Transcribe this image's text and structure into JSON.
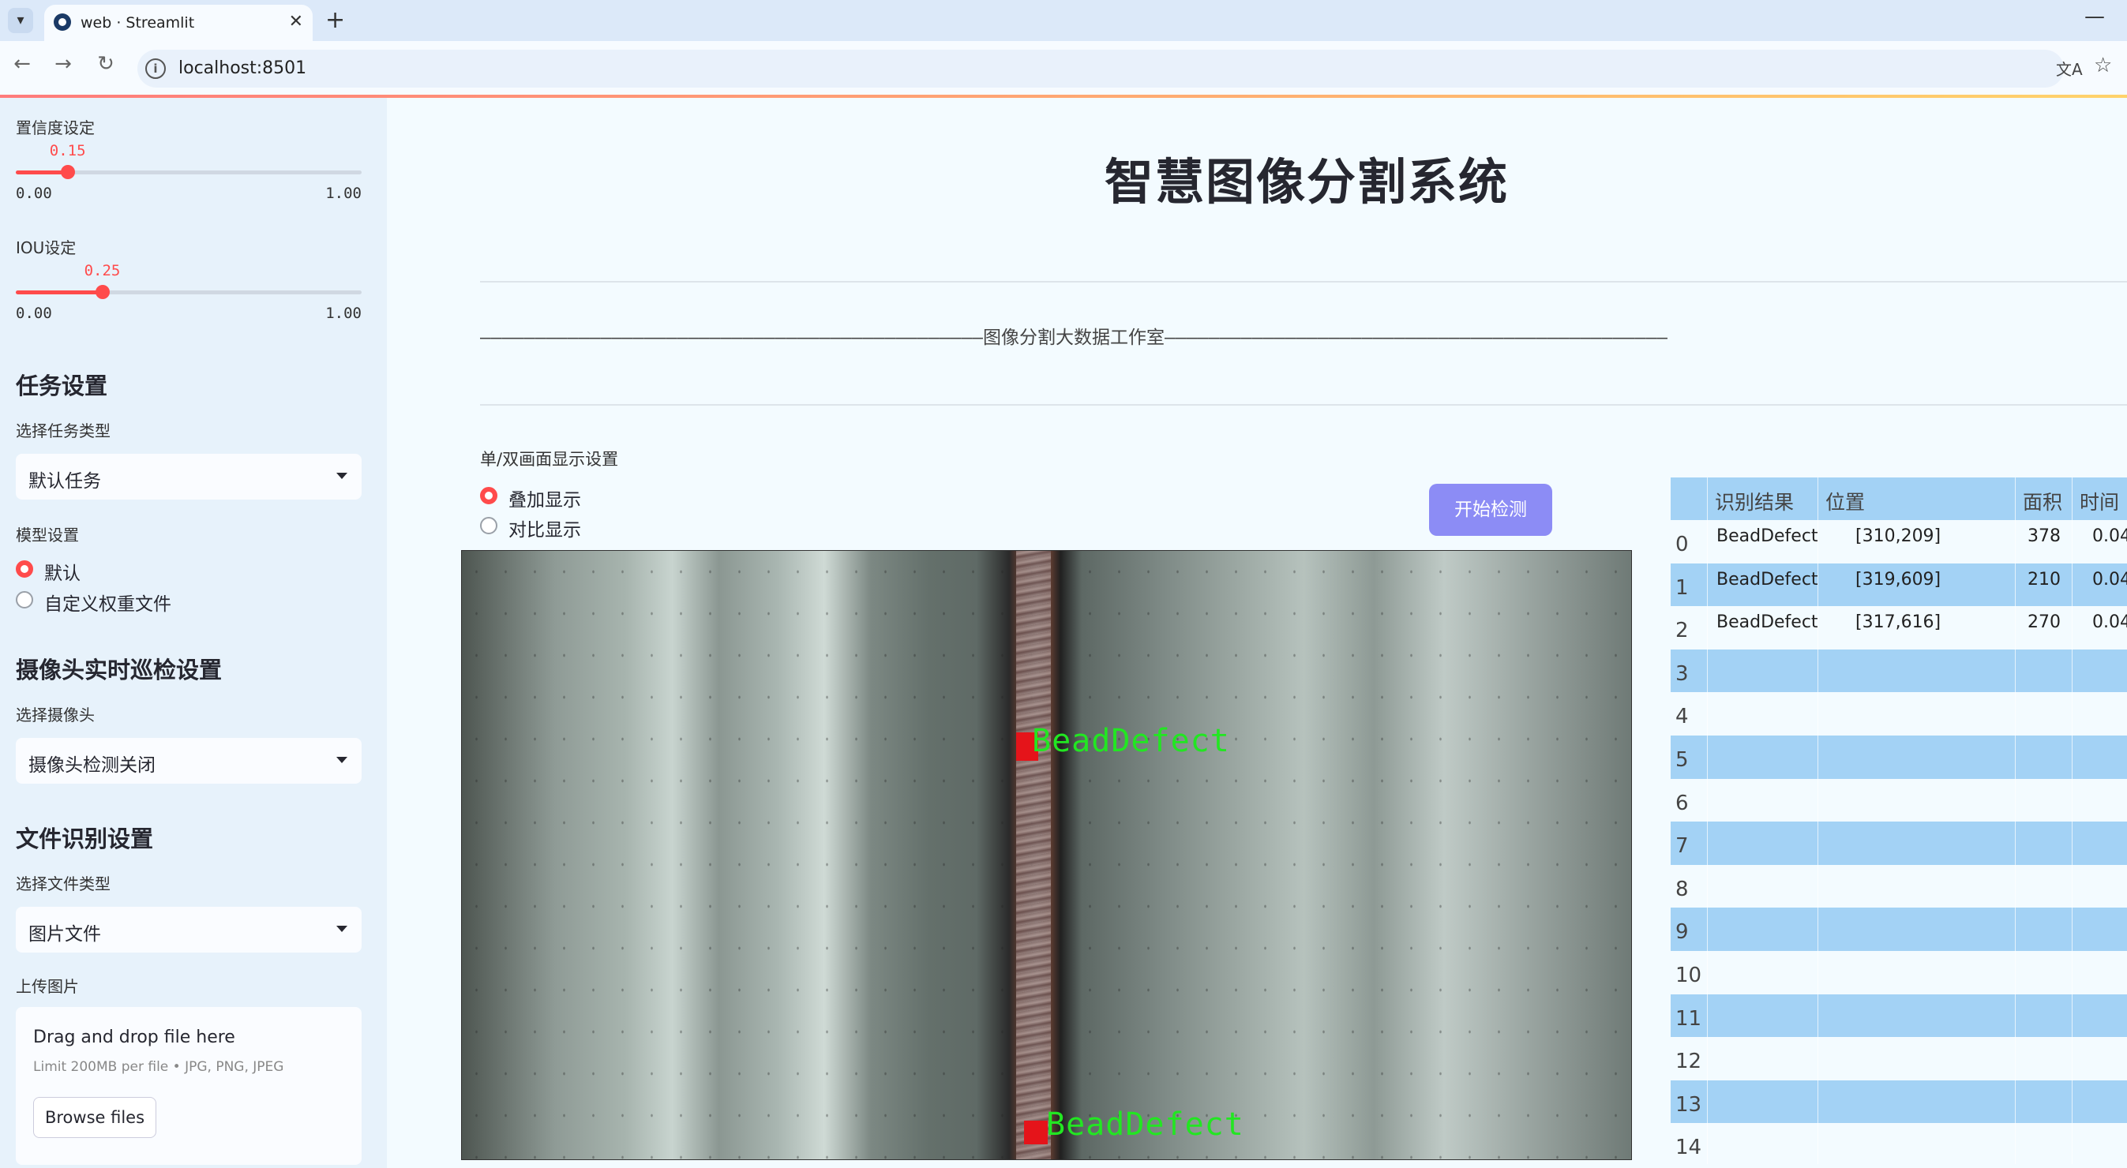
{
  "browser": {
    "tab_title": "web · Streamlit",
    "tab_dropdown_icon": "▾",
    "tab_close_icon": "✕",
    "new_tab_icon": "+",
    "minimize_icon": "—",
    "back_icon": "←",
    "forward_icon": "→",
    "reload_icon": "↻",
    "info_icon": "i",
    "url": "localhost:8501",
    "translate_icon": "文A",
    "bookmark_icon": "☆"
  },
  "sidebar": {
    "confidence": {
      "label": "置信度设定",
      "value": "0.15",
      "fraction": 0.15,
      "min": "0.00",
      "max": "1.00"
    },
    "iou": {
      "label": "IOU设定",
      "value": "0.25",
      "fraction": 0.25,
      "min": "0.00",
      "max": "1.00"
    },
    "task_heading": "任务设置",
    "task_type_label": "选择任务类型",
    "task_type_value": "默认任务",
    "model_label": "模型设置",
    "model_options": [
      "默认",
      "自定义权重文件"
    ],
    "camera_heading": "摄像头实时巡检设置",
    "camera_label": "选择摄像头",
    "camera_value": "摄像头检测关闭",
    "file_heading": "文件识别设置",
    "file_type_label": "选择文件类型",
    "file_type_value": "图片文件",
    "upload_label": "上传图片",
    "upload_title": "Drag and drop file here",
    "upload_limit": "Limit 200MB per file • JPG, PNG, JPEG",
    "browse_label": "Browse files"
  },
  "main": {
    "title": "智慧图像分割系统",
    "banner": "——————————————————————————————————————————————图像分割大数据工作室——————————————————————————————————————————————",
    "display_label": "单/双画面显示设置",
    "display_options": [
      "叠加显示",
      "对比显示"
    ],
    "start_button": "开始检测",
    "detections": [
      {
        "label": "BeadDefect"
      },
      {
        "label": "BeadDefect"
      }
    ]
  },
  "table": {
    "headers": [
      "识别结果",
      "位置",
      "面积",
      "时间"
    ],
    "rows": [
      {
        "idx": "0",
        "result": "BeadDefect",
        "pos": "[310,209]",
        "area": "378",
        "time": "0.04"
      },
      {
        "idx": "1",
        "result": "BeadDefect",
        "pos": "[319,609]",
        "area": "210",
        "time": "0.04"
      },
      {
        "idx": "2",
        "result": "BeadDefect",
        "pos": "[317,616]",
        "area": "270",
        "time": "0.04"
      },
      {
        "idx": "3",
        "result": "",
        "pos": "",
        "area": "",
        "time": ""
      },
      {
        "idx": "4",
        "result": "",
        "pos": "",
        "area": "",
        "time": ""
      },
      {
        "idx": "5",
        "result": "",
        "pos": "",
        "area": "",
        "time": ""
      },
      {
        "idx": "6",
        "result": "",
        "pos": "",
        "area": "",
        "time": ""
      },
      {
        "idx": "7",
        "result": "",
        "pos": "",
        "area": "",
        "time": ""
      },
      {
        "idx": "8",
        "result": "",
        "pos": "",
        "area": "",
        "time": ""
      },
      {
        "idx": "9",
        "result": "",
        "pos": "",
        "area": "",
        "time": ""
      },
      {
        "idx": "10",
        "result": "",
        "pos": "",
        "area": "",
        "time": ""
      },
      {
        "idx": "11",
        "result": "",
        "pos": "",
        "area": "",
        "time": ""
      },
      {
        "idx": "12",
        "result": "",
        "pos": "",
        "area": "",
        "time": ""
      },
      {
        "idx": "13",
        "result": "",
        "pos": "",
        "area": "",
        "time": ""
      },
      {
        "idx": "14",
        "result": "",
        "pos": "",
        "area": "",
        "time": ""
      }
    ]
  },
  "colors": {
    "accent": "#ff4b4b",
    "button": "#8c8cf5",
    "table_stripe": "#a3d2f5",
    "detection_label": "#22e622",
    "detection_box": "#e5141a"
  }
}
